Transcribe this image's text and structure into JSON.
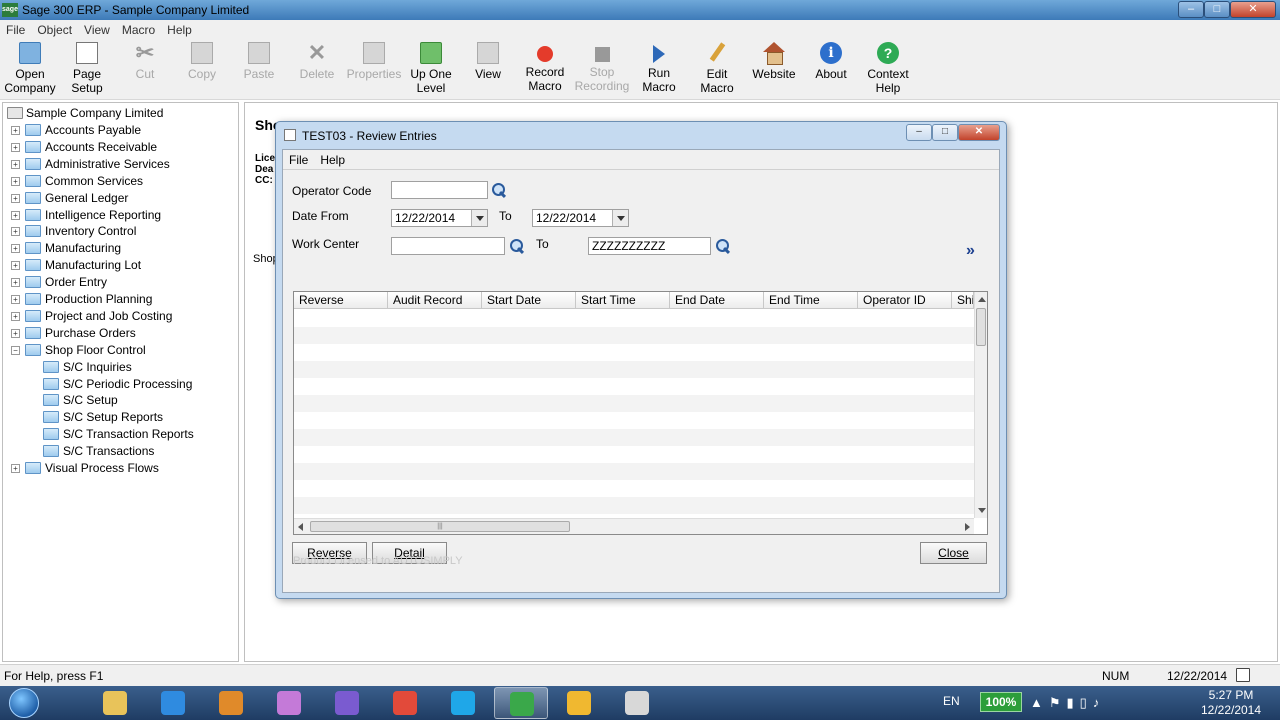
{
  "window": {
    "title": "Sage 300 ERP - Sample Company Limited",
    "app_icon_text": "sage",
    "controls": {
      "minimize": "–",
      "maximize": "□",
      "close": "✕"
    }
  },
  "menubar": [
    "File",
    "Object",
    "View",
    "Macro",
    "Help"
  ],
  "toolbar": [
    {
      "line1": "Open",
      "line2": "Company",
      "icon": "folder-icon",
      "enabled": true
    },
    {
      "line1": "Page",
      "line2": "Setup",
      "icon": "page-setup-icon",
      "enabled": true
    },
    {
      "line1": "Cut",
      "line2": "",
      "icon": "cut-icon",
      "enabled": false
    },
    {
      "line1": "Copy",
      "line2": "",
      "icon": "copy-icon",
      "enabled": false
    },
    {
      "line1": "Paste",
      "line2": "",
      "icon": "paste-icon",
      "enabled": false
    },
    {
      "line1": "Delete",
      "line2": "",
      "icon": "delete-icon",
      "enabled": false
    },
    {
      "line1": "Properties",
      "line2": "",
      "icon": "properties-icon",
      "enabled": false
    },
    {
      "line1": "Up One",
      "line2": "Level",
      "icon": "up-level-icon",
      "enabled": true
    },
    {
      "line1": "View",
      "line2": "",
      "icon": "view-icon",
      "enabled": true
    },
    {
      "line1": "Record",
      "line2": "Macro",
      "icon": "record-icon",
      "enabled": true
    },
    {
      "line1": "Stop",
      "line2": "Recording",
      "icon": "stop-icon",
      "enabled": false
    },
    {
      "line1": "Run",
      "line2": "Macro",
      "icon": "play-icon",
      "enabled": true
    },
    {
      "line1": "Edit",
      "line2": "Macro",
      "icon": "pencil-icon",
      "enabled": true
    },
    {
      "line1": "Website",
      "line2": "",
      "icon": "house-icon",
      "enabled": true
    },
    {
      "line1": "About",
      "line2": "",
      "icon": "info-icon",
      "enabled": true
    },
    {
      "line1": "Context",
      "line2": "Help",
      "icon": "help-icon",
      "enabled": true
    }
  ],
  "tree": {
    "root": "Sample Company Limited",
    "items": [
      {
        "label": "Accounts Payable",
        "expanded": false
      },
      {
        "label": "Accounts Receivable",
        "expanded": false
      },
      {
        "label": "Administrative Services",
        "expanded": false
      },
      {
        "label": "Common Services",
        "expanded": false
      },
      {
        "label": "General Ledger",
        "expanded": false
      },
      {
        "label": "Intelligence Reporting",
        "expanded": null
      },
      {
        "label": "Inventory Control",
        "expanded": false
      },
      {
        "label": "Manufacturing",
        "expanded": false
      },
      {
        "label": "Manufacturing Lot",
        "expanded": false
      },
      {
        "label": "Order Entry",
        "expanded": false
      },
      {
        "label": "Production Planning",
        "expanded": false
      },
      {
        "label": "Project and Job Costing",
        "expanded": false
      },
      {
        "label": "Purchase Orders",
        "expanded": false
      },
      {
        "label": "Shop Floor Control",
        "expanded": true
      },
      {
        "label": "S/C Inquiries",
        "child": true
      },
      {
        "label": "S/C Periodic Processing",
        "child": true
      },
      {
        "label": "S/C Setup",
        "child": true
      },
      {
        "label": "S/C Setup Reports",
        "child": true
      },
      {
        "label": "S/C Transaction Reports",
        "child": true
      },
      {
        "label": "S/C Transactions",
        "child": true
      },
      {
        "label": "Visual Process Flows",
        "expanded": false
      }
    ]
  },
  "right_pane": {
    "title": "Sho",
    "lines": [
      "Lice",
      "Dea",
      "CC:"
    ],
    "shop_label": "Shop"
  },
  "dialog": {
    "title": "TEST03 - Review Entries",
    "menu": [
      "File",
      "Help"
    ],
    "operator_code": {
      "label": "Operator Code",
      "value": ""
    },
    "date_from": {
      "label": "Date From",
      "value": "12/22/2014",
      "to_label": "To",
      "to_value": "12/22/2014"
    },
    "work_center": {
      "label": "Work Center",
      "value": "",
      "to_label": "To",
      "to_value": "ZZZZZZZZZZ"
    },
    "expand_glyph": "»",
    "grid_columns": [
      "Reverse",
      "Audit Record",
      "Start Date",
      "Start Time",
      "End Date",
      "End Time",
      "Operator ID",
      "Shif"
    ],
    "buttons": {
      "reverse": "Reverse",
      "detail": "Detail",
      "close": "Close"
    },
    "license_text": "Product Licensed to AUTOSIMPLY"
  },
  "statusbar": {
    "help": "For Help, press F1",
    "num": "NUM",
    "date": "12/22/2014"
  },
  "taskbar": {
    "language": "EN",
    "battery": "100%",
    "time": "5:27 PM",
    "date": "12/22/2014",
    "apps": [
      "file-explorer-icon",
      "internet-explorer-icon",
      "outlook-icon",
      "messenger-icon",
      "viber-icon",
      "chrome-icon",
      "skype-icon",
      "sage-icon",
      "flower-app-icon",
      "document-app-icon"
    ]
  }
}
